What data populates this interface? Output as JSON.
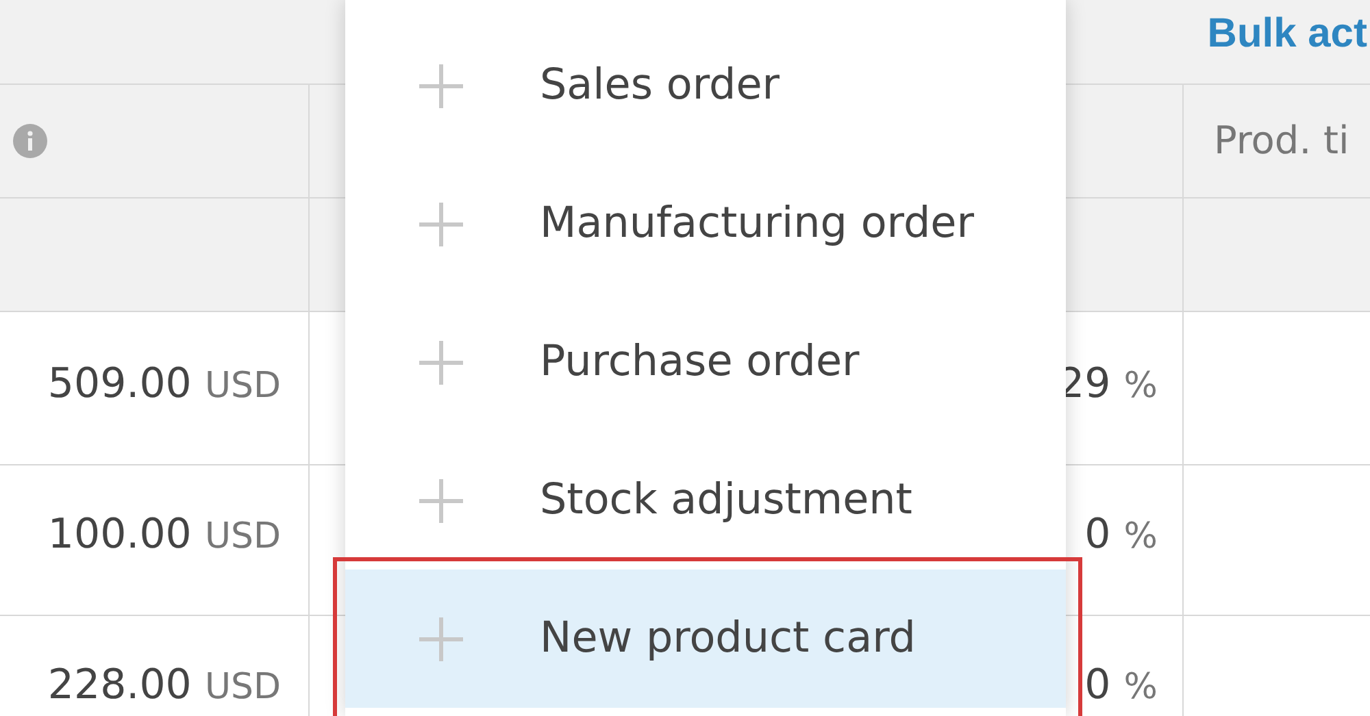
{
  "toolbar": {
    "bulk_actions": "Bulk act"
  },
  "table": {
    "column_4_header": "Prod. ti",
    "rows": [
      {
        "price": "509.00",
        "currency": "USD",
        "percent": "29",
        "percent_unit": "%"
      },
      {
        "price": "100.00",
        "currency": "USD",
        "percent": "0",
        "percent_unit": "%"
      },
      {
        "price": "228.00",
        "currency": "USD",
        "percent": "0",
        "percent_unit": "%"
      }
    ]
  },
  "menu": {
    "items": [
      {
        "label": "Sales order",
        "selected": false
      },
      {
        "label": "Manufacturing order",
        "selected": false
      },
      {
        "label": "Purchase order",
        "selected": false
      },
      {
        "label": "Stock adjustment",
        "selected": false
      },
      {
        "label": "New product card",
        "selected": true
      }
    ]
  }
}
